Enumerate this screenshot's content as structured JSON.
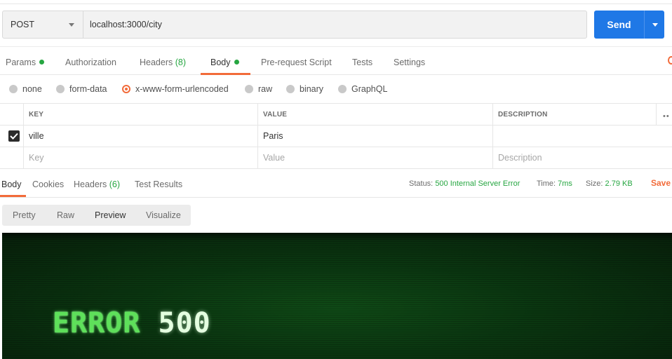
{
  "request": {
    "method": "POST",
    "url": "localhost:3000/city",
    "send_label": "Send"
  },
  "request_tabs": [
    {
      "label": "Params",
      "indicator": "dot"
    },
    {
      "label": "Authorization"
    },
    {
      "label": "Headers",
      "count": "(8)"
    },
    {
      "label": "Body",
      "indicator": "dot",
      "active": true
    },
    {
      "label": "Pre-request Script"
    },
    {
      "label": "Tests"
    },
    {
      "label": "Settings"
    }
  ],
  "body_types": [
    {
      "label": "none"
    },
    {
      "label": "form-data"
    },
    {
      "label": "x-www-form-urlencoded",
      "selected": true
    },
    {
      "label": "raw"
    },
    {
      "label": "binary"
    },
    {
      "label": "GraphQL"
    }
  ],
  "params_table": {
    "headers": [
      "KEY",
      "VALUE",
      "DESCRIPTION"
    ],
    "rows": [
      {
        "checked": true,
        "key": "ville",
        "value": "Paris",
        "description": ""
      }
    ],
    "placeholders": {
      "key": "Key",
      "value": "Value",
      "description": "Description"
    }
  },
  "response": {
    "tabs": [
      {
        "label": "Body",
        "active": true
      },
      {
        "label": "Cookies"
      },
      {
        "label": "Headers",
        "count": "(6)"
      },
      {
        "label": "Test Results"
      }
    ],
    "status_label": "Status:",
    "status_value": "500 Internal Server Error",
    "time_label": "Time:",
    "time_value": "7ms",
    "size_label": "Size:",
    "size_value": "2.79 KB",
    "save_label": "Save",
    "view_tabs": [
      {
        "label": "Pretty"
      },
      {
        "label": "Raw"
      },
      {
        "label": "Preview",
        "active": true
      },
      {
        "label": "Visualize"
      }
    ],
    "preview": {
      "error_word": "ERROR",
      "error_code": "500"
    }
  },
  "colors": {
    "accent": "#f26b3a",
    "send_button": "#1f78e6",
    "success_green": "#26a641",
    "preview_background": "#0a3510",
    "error_text": "#5ee05a"
  }
}
